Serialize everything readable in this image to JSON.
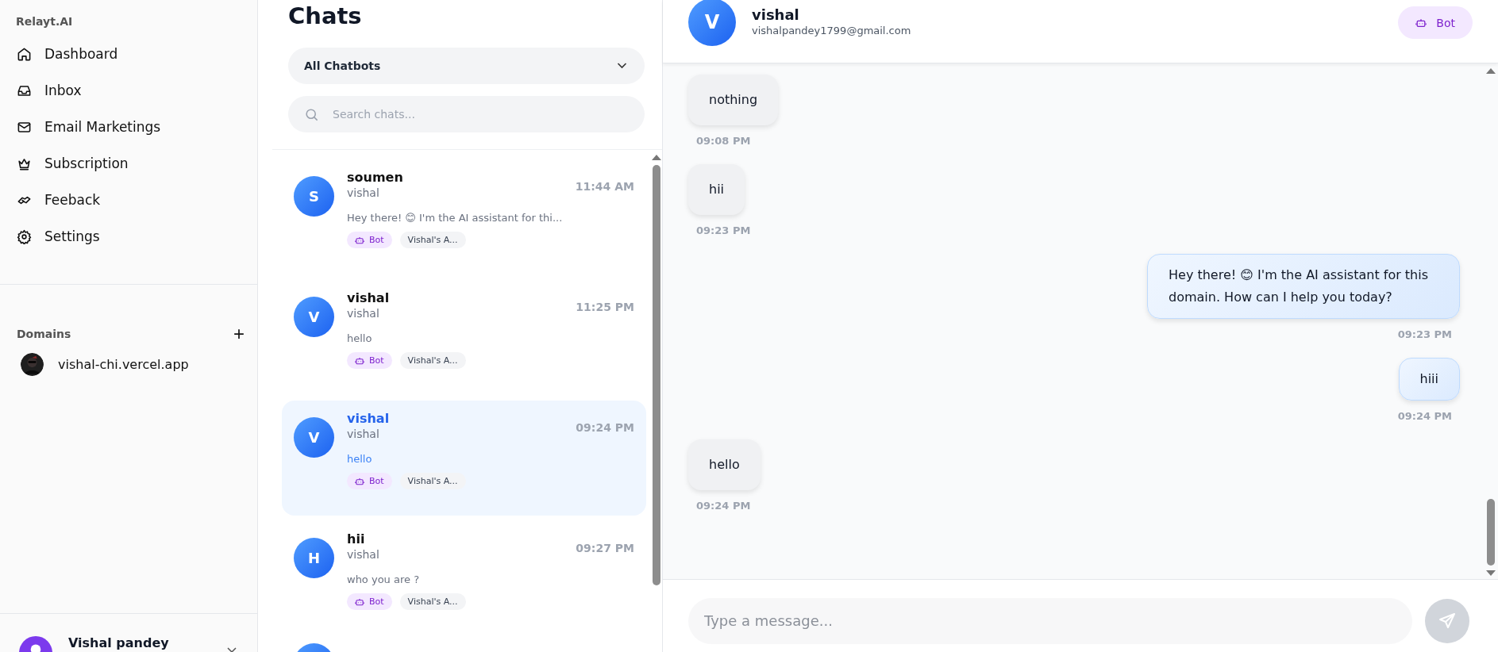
{
  "sidebar": {
    "brand": "Relayt.AI",
    "items": [
      {
        "label": "Dashboard",
        "kind": "home",
        "selected": false
      },
      {
        "label": "Inbox",
        "kind": "inbox",
        "selected": false
      },
      {
        "label": "Email Marketings",
        "kind": "mail",
        "selected": false
      },
      {
        "label": "Subscription",
        "kind": "crown",
        "selected": false
      },
      {
        "label": "Feeback",
        "kind": "handshake",
        "selected": false
      },
      {
        "label": "Settings",
        "kind": "gear",
        "selected": false
      }
    ],
    "domains_heading": "Domains",
    "add_button": "+",
    "domains": [
      {
        "label": "vishal-chi.vercel.app"
      }
    ],
    "user": {
      "name": "Vishal pandey"
    }
  },
  "chat_list": {
    "title": "Chats",
    "filter": "All Chatbots",
    "search": {
      "placeholder": "Search chats..."
    },
    "chats": [
      {
        "initial": "S",
        "name": "soumen",
        "sub": "vishal",
        "time": "11:44 AM",
        "preview": "Hey there! 😊 I'm the AI assistant for thi...",
        "tags": [
          "Bot",
          "Vishal's A..."
        ],
        "selected": false
      },
      {
        "initial": "V",
        "name": "vishal",
        "sub": "vishal",
        "time": "11:25 PM",
        "preview": "hello",
        "tags": [
          "Bot",
          "Vishal's A..."
        ],
        "selected": false
      },
      {
        "initial": "V",
        "name": "vishal",
        "sub": "vishal",
        "time": "09:24 PM",
        "preview": "hello",
        "tags": [
          "Bot",
          "Vishal's A..."
        ],
        "selected": true
      },
      {
        "initial": "H",
        "name": "hii",
        "sub": "vishal",
        "time": "09:27 PM",
        "preview": "who you are ?",
        "tags": [
          "Bot",
          "Vishal's A..."
        ],
        "selected": false
      }
    ]
  },
  "conversation": {
    "contact": {
      "initial": "V",
      "name": "vishal",
      "email": "vishalpandey1799@gmail.com"
    },
    "mode": "Bot",
    "messages": [
      {
        "kind": "received",
        "text": "nothing",
        "time": "09:08 PM"
      },
      {
        "kind": "received",
        "text": "hii",
        "time": "09:23 PM"
      },
      {
        "kind": "sent",
        "text": "Hey there! 😊 I'm the AI assistant for this domain. How can I help you today?",
        "time": "09:23 PM"
      },
      {
        "kind": "sent",
        "text": "hiii",
        "time": "09:24 PM"
      },
      {
        "kind": "received",
        "text": "hello",
        "time": "09:24 PM"
      }
    ],
    "composer": {
      "placeholder": "Type a message..."
    }
  }
}
